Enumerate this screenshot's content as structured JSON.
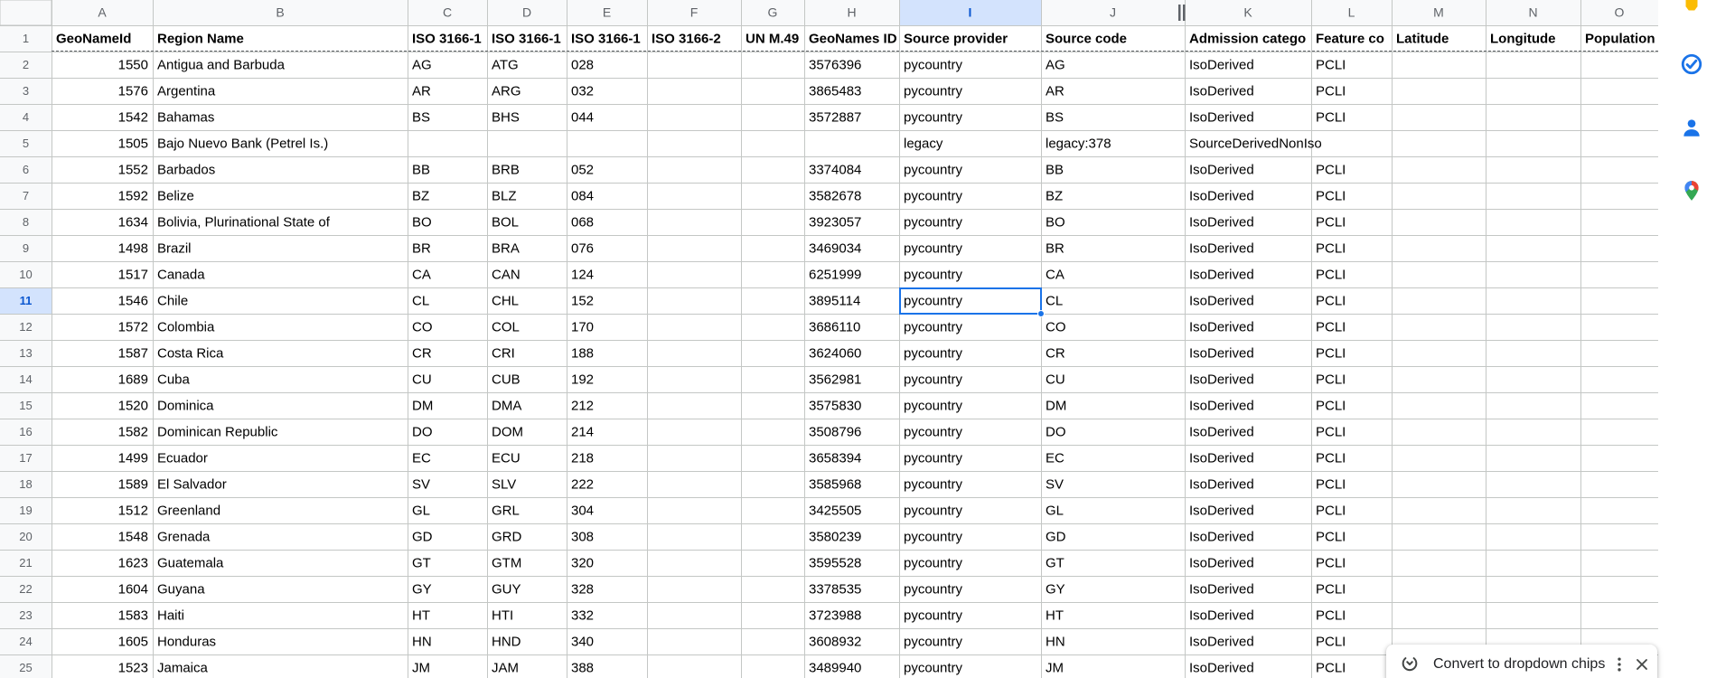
{
  "grid": {
    "columns": [
      "A",
      "B",
      "C",
      "D",
      "E",
      "F",
      "G",
      "H",
      "I",
      "J",
      "K",
      "L",
      "M",
      "N",
      "O"
    ],
    "selected_column": "I",
    "selected_row": 11,
    "selected_cell": "I11",
    "header_row": [
      "GeoNameId",
      "Region Name",
      "ISO 3166-1",
      "ISO 3166-1",
      "ISO 3166-1",
      "ISO 3166-2",
      "UN M.49",
      "GeoNames ID",
      "Source provider",
      "Source code",
      "Admission catego",
      "Feature co",
      "Latitude",
      "Longitude",
      "Population"
    ],
    "rows": [
      {
        "row": 2,
        "cells": [
          "1550",
          "Antigua and Barbuda",
          "AG",
          "ATG",
          "028",
          "",
          "",
          "3576396",
          "pycountry",
          "AG",
          "IsoDerived",
          "PCLI",
          "",
          "",
          ""
        ]
      },
      {
        "row": 3,
        "cells": [
          "1576",
          "Argentina",
          "AR",
          "ARG",
          "032",
          "",
          "",
          "3865483",
          "pycountry",
          "AR",
          "IsoDerived",
          "PCLI",
          "",
          "",
          ""
        ]
      },
      {
        "row": 4,
        "cells": [
          "1542",
          "Bahamas",
          "BS",
          "BHS",
          "044",
          "",
          "",
          "3572887",
          "pycountry",
          "BS",
          "IsoDerived",
          "PCLI",
          "",
          "",
          ""
        ]
      },
      {
        "row": 5,
        "cells": [
          "1505",
          "Bajo Nuevo Bank (Petrel Is.)",
          "",
          "",
          "",
          "",
          "",
          "",
          "legacy",
          "legacy:378",
          "SourceDerivedNonIso",
          "",
          "",
          "",
          ""
        ]
      },
      {
        "row": 6,
        "cells": [
          "1552",
          "Barbados",
          "BB",
          "BRB",
          "052",
          "",
          "",
          "3374084",
          "pycountry",
          "BB",
          "IsoDerived",
          "PCLI",
          "",
          "",
          ""
        ]
      },
      {
        "row": 7,
        "cells": [
          "1592",
          "Belize",
          "BZ",
          "BLZ",
          "084",
          "",
          "",
          "3582678",
          "pycountry",
          "BZ",
          "IsoDerived",
          "PCLI",
          "",
          "",
          ""
        ]
      },
      {
        "row": 8,
        "cells": [
          "1634",
          "Bolivia, Plurinational State of",
          "BO",
          "BOL",
          "068",
          "",
          "",
          "3923057",
          "pycountry",
          "BO",
          "IsoDerived",
          "PCLI",
          "",
          "",
          ""
        ]
      },
      {
        "row": 9,
        "cells": [
          "1498",
          "Brazil",
          "BR",
          "BRA",
          "076",
          "",
          "",
          "3469034",
          "pycountry",
          "BR",
          "IsoDerived",
          "PCLI",
          "",
          "",
          ""
        ]
      },
      {
        "row": 10,
        "cells": [
          "1517",
          "Canada",
          "CA",
          "CAN",
          "124",
          "",
          "",
          "6251999",
          "pycountry",
          "CA",
          "IsoDerived",
          "PCLI",
          "",
          "",
          ""
        ]
      },
      {
        "row": 11,
        "cells": [
          "1546",
          "Chile",
          "CL",
          "CHL",
          "152",
          "",
          "",
          "3895114",
          "pycountry",
          "CL",
          "IsoDerived",
          "PCLI",
          "",
          "",
          ""
        ]
      },
      {
        "row": 12,
        "cells": [
          "1572",
          "Colombia",
          "CO",
          "COL",
          "170",
          "",
          "",
          "3686110",
          "pycountry",
          "CO",
          "IsoDerived",
          "PCLI",
          "",
          "",
          ""
        ]
      },
      {
        "row": 13,
        "cells": [
          "1587",
          "Costa Rica",
          "CR",
          "CRI",
          "188",
          "",
          "",
          "3624060",
          "pycountry",
          "CR",
          "IsoDerived",
          "PCLI",
          "",
          "",
          ""
        ]
      },
      {
        "row": 14,
        "cells": [
          "1689",
          "Cuba",
          "CU",
          "CUB",
          "192",
          "",
          "",
          "3562981",
          "pycountry",
          "CU",
          "IsoDerived",
          "PCLI",
          "",
          "",
          ""
        ]
      },
      {
        "row": 15,
        "cells": [
          "1520",
          "Dominica",
          "DM",
          "DMA",
          "212",
          "",
          "",
          "3575830",
          "pycountry",
          "DM",
          "IsoDerived",
          "PCLI",
          "",
          "",
          ""
        ]
      },
      {
        "row": 16,
        "cells": [
          "1582",
          "Dominican Republic",
          "DO",
          "DOM",
          "214",
          "",
          "",
          "3508796",
          "pycountry",
          "DO",
          "IsoDerived",
          "PCLI",
          "",
          "",
          ""
        ]
      },
      {
        "row": 17,
        "cells": [
          "1499",
          "Ecuador",
          "EC",
          "ECU",
          "218",
          "",
          "",
          "3658394",
          "pycountry",
          "EC",
          "IsoDerived",
          "PCLI",
          "",
          "",
          ""
        ]
      },
      {
        "row": 18,
        "cells": [
          "1589",
          "El Salvador",
          "SV",
          "SLV",
          "222",
          "",
          "",
          "3585968",
          "pycountry",
          "SV",
          "IsoDerived",
          "PCLI",
          "",
          "",
          ""
        ]
      },
      {
        "row": 19,
        "cells": [
          "1512",
          "Greenland",
          "GL",
          "GRL",
          "304",
          "",
          "",
          "3425505",
          "pycountry",
          "GL",
          "IsoDerived",
          "PCLI",
          "",
          "",
          ""
        ]
      },
      {
        "row": 20,
        "cells": [
          "1548",
          "Grenada",
          "GD",
          "GRD",
          "308",
          "",
          "",
          "3580239",
          "pycountry",
          "GD",
          "IsoDerived",
          "PCLI",
          "",
          "",
          ""
        ]
      },
      {
        "row": 21,
        "cells": [
          "1623",
          "Guatemala",
          "GT",
          "GTM",
          "320",
          "",
          "",
          "3595528",
          "pycountry",
          "GT",
          "IsoDerived",
          "PCLI",
          "",
          "",
          ""
        ]
      },
      {
        "row": 22,
        "cells": [
          "1604",
          "Guyana",
          "GY",
          "GUY",
          "328",
          "",
          "",
          "3378535",
          "pycountry",
          "GY",
          "IsoDerived",
          "PCLI",
          "",
          "",
          ""
        ]
      },
      {
        "row": 23,
        "cells": [
          "1583",
          "Haiti",
          "HT",
          "HTI",
          "332",
          "",
          "",
          "3723988",
          "pycountry",
          "HT",
          "IsoDerived",
          "PCLI",
          "",
          "",
          ""
        ]
      },
      {
        "row": 24,
        "cells": [
          "1605",
          "Honduras",
          "HN",
          "HND",
          "340",
          "",
          "",
          "3608932",
          "pycountry",
          "HN",
          "IsoDerived",
          "PCLI",
          "",
          "",
          ""
        ]
      },
      {
        "row": 25,
        "cells": [
          "1523",
          "Jamaica",
          "JM",
          "JAM",
          "388",
          "",
          "",
          "3489940",
          "pycountry",
          "JM",
          "IsoDerived",
          "PCLI",
          "",
          "",
          ""
        ]
      }
    ]
  },
  "toast": {
    "label": "Convert to dropdown chips",
    "icon": "dropdown-chip-icon"
  },
  "side_panel": {
    "icons": [
      "keep-icon",
      "tasks-icon",
      "contacts-icon",
      "maps-icon"
    ]
  },
  "colors": {
    "grid_line": "#e2e3e3",
    "header_bg": "#f8f9fa",
    "header_text": "#5f6368",
    "selection_blue": "#1a73e8",
    "selected_header_bg": "#d3e3fd",
    "keep_yellow": "#fbbc04",
    "tasks_blue": "#1a73e8",
    "contacts_blue": "#1a73e8",
    "maps_red": "#ea4335",
    "maps_green": "#34a853",
    "maps_blue": "#4285f4"
  }
}
